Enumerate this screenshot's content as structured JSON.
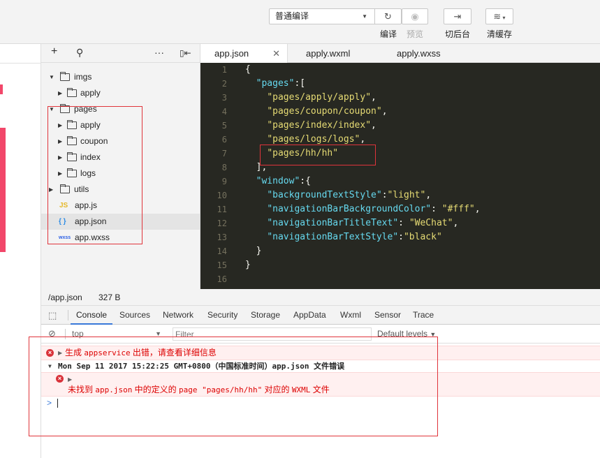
{
  "toolbar": {
    "mode": "普通编译",
    "compile_label": "编译",
    "preview_label": "预览",
    "background_label": "切后台",
    "clear_cache_label": "清缓存"
  },
  "tree": {
    "rows": [
      {
        "name": "imgs",
        "type": "folder",
        "expanded": true
      },
      {
        "name": "apply",
        "type": "folder",
        "expanded": false
      },
      {
        "name": "pages",
        "type": "folder",
        "expanded": true
      },
      {
        "name": "apply",
        "type": "folder",
        "expanded": false
      },
      {
        "name": "coupon",
        "type": "folder",
        "expanded": false
      },
      {
        "name": "index",
        "type": "folder",
        "expanded": false
      },
      {
        "name": "logs",
        "type": "folder",
        "expanded": false
      },
      {
        "name": "utils",
        "type": "folder",
        "expanded": false
      },
      {
        "name": "app.js",
        "type": "js",
        "badge": "JS"
      },
      {
        "name": "app.json",
        "type": "json",
        "badge": "{ }"
      },
      {
        "name": "app.wxss",
        "type": "wxss",
        "badge": "wxss"
      }
    ]
  },
  "tabs": [
    "app.json",
    "apply.wxml",
    "apply.wxss"
  ],
  "code": [
    "{",
    "  \"pages\":[",
    "    \"pages/apply/apply\",",
    "    \"pages/coupon/coupon\",",
    "    \"pages/index/index\",",
    "    \"pages/logs/logs\",",
    "    \"pages/hh/hh\"",
    "  ],",
    "  \"window\":{",
    "    \"backgroundTextStyle\":\"light\",",
    "    \"navigationBarBackgroundColor\": \"#fff\",",
    "    \"navigationBarTitleText\": \"WeChat\",",
    "    \"navigationBarTextStyle\":\"black\"",
    "  }",
    "}",
    ""
  ],
  "status": {
    "path": "/app.json",
    "size": "327 B"
  },
  "devtools": {
    "tabs": [
      "Console",
      "Sources",
      "Network",
      "Security",
      "Storage",
      "AppData",
      "Wxml",
      "Sensor",
      "Trace"
    ],
    "context": "top",
    "filter_placeholder": "Filter",
    "levels": "Default levels"
  },
  "console": {
    "line1_prefix": "生成 ",
    "line1_code": "appservice",
    "line1_suffix": " 出错，请查看详细信息",
    "line2": "Mon Sep 11 2017 15:22:25 GMT+0800（中国标准时间）app.json 文件错误",
    "line3a": "未找到 ",
    "line3b": "app.json",
    "line3c": " 中的定义的 ",
    "line3d": "page \"pages/hh/hh\"",
    "line3e": " 对应的 ",
    "line3f": "WXML",
    "line3g": " 文件",
    "prompt": ">"
  }
}
